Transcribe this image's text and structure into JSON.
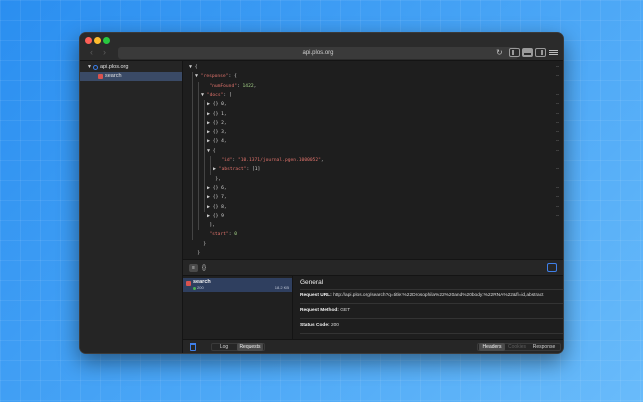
{
  "window": {
    "address": "api.plos.org",
    "nav_back": "‹",
    "nav_forward": "›",
    "reload_icon": "↻"
  },
  "sidebar": {
    "host": "api.plos.org",
    "items": [
      {
        "label": "search"
      }
    ]
  },
  "json_viewer": {
    "lines": [
      {
        "depth": 0,
        "arrow": "▼",
        "text": "{"
      },
      {
        "depth": 1,
        "arrow": "▼",
        "key": "\"response\"",
        "text": ": {"
      },
      {
        "depth": 2,
        "arrow": "",
        "key": "\"numFound\"",
        "sep": ": ",
        "num": "1422",
        "text": ","
      },
      {
        "depth": 2,
        "arrow": "▼",
        "key": "\"docs\"",
        "text": ": ["
      },
      {
        "depth": 3,
        "arrow": "▶",
        "text": "{} 0,"
      },
      {
        "depth": 3,
        "arrow": "▶",
        "text": "{} 1,"
      },
      {
        "depth": 3,
        "arrow": "▶",
        "text": "{} 2,"
      },
      {
        "depth": 3,
        "arrow": "▶",
        "text": "{} 3,"
      },
      {
        "depth": 3,
        "arrow": "▶",
        "text": "{} 4,"
      },
      {
        "depth": 3,
        "arrow": "▼",
        "text": "{"
      },
      {
        "depth": 4,
        "arrow": "",
        "key": "\"id\"",
        "sep": ": ",
        "str": "\"10.1371/journal.pgen.1000052\"",
        "text": ","
      },
      {
        "depth": 4,
        "arrow": "▶",
        "key": "\"abstract\"",
        "text": ": [1]"
      },
      {
        "depth": 3,
        "arrow": "",
        "text": "},"
      },
      {
        "depth": 3,
        "arrow": "▶",
        "text": "{} 6,"
      },
      {
        "depth": 3,
        "arrow": "▶",
        "text": "{} 7,"
      },
      {
        "depth": 3,
        "arrow": "▶",
        "text": "{} 8,"
      },
      {
        "depth": 3,
        "arrow": "▶",
        "text": "{} 9"
      },
      {
        "depth": 2,
        "arrow": "",
        "text": "],"
      },
      {
        "depth": 2,
        "arrow": "",
        "key": "\"start\"",
        "sep": ": ",
        "num": "0"
      },
      {
        "depth": 1,
        "arrow": "",
        "text": "}"
      },
      {
        "depth": 0,
        "arrow": "",
        "text": "}"
      }
    ]
  },
  "bottom_toolbar": {
    "format_label": "{}"
  },
  "requests": [
    {
      "name": "search",
      "status": "200",
      "size": "18.2 KB"
    }
  ],
  "detail": {
    "title": "General",
    "request_url_label": "Request URL:",
    "request_url": "http://api.plos.org/search?q=title:%22Drosophila%22%20and%20body:%22RNA%22&fl=id,abstract",
    "request_method_label": "Request Method:",
    "request_method": "GET",
    "status_code_label": "Status Code:",
    "status_code": "200"
  },
  "footer": {
    "log": "Log",
    "requests": "Requests",
    "headers": "Headers",
    "cookies": "Cookies",
    "response": "Response"
  },
  "colors": {
    "accent": "#3f7fe8",
    "key": "#e2736c",
    "number": "#a9d98b"
  }
}
